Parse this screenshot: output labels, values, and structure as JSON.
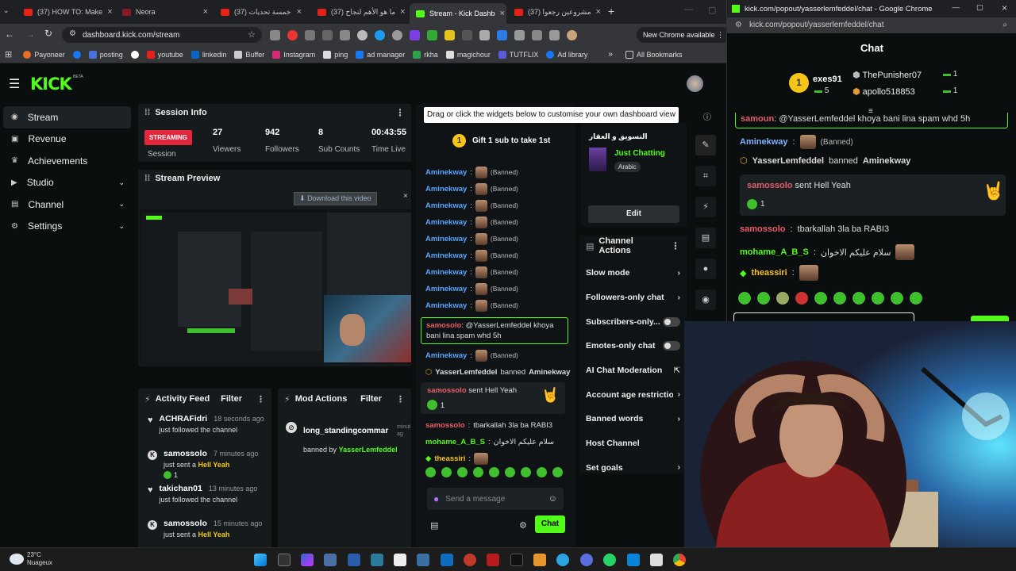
{
  "tabs": [
    {
      "label": "(37) HOW TO: Make",
      "color": "#e62117"
    },
    {
      "label": "Neora",
      "color": "#8a1a2a"
    },
    {
      "label": "(37) خمسة تحديات",
      "color": "#e62117"
    },
    {
      "label": "(37) ما هو الأهم لنجاح",
      "color": "#e62117"
    },
    {
      "label": "Stream - Kick Dashb",
      "color": "#53fc18"
    },
    {
      "label": "(37) مشروعين رجعوا",
      "color": "#e62117"
    }
  ],
  "address": {
    "url": "dashboard.kick.com/stream",
    "new_chrome": "New Chrome available"
  },
  "bookmarks": [
    "Payoneer",
    "posting",
    "youtube",
    "linkedin",
    "Buffer",
    "Instagram",
    "ping",
    "ad manager",
    "rkha",
    "magichour",
    "TUTFLIX",
    "Ad library"
  ],
  "bookmarks_all": "All Bookmarks",
  "kick_logo": "KICK",
  "kick_beta": "BETA",
  "nav": [
    {
      "label": "Stream",
      "icon": "broadcast-icon",
      "active": true
    },
    {
      "label": "Revenue",
      "icon": "wallet-icon"
    },
    {
      "label": "Achievements",
      "icon": "trophy-icon"
    },
    {
      "label": "Studio",
      "icon": "studio-icon",
      "chevron": true
    },
    {
      "label": "Channel",
      "icon": "channel-icon",
      "chevron": true
    },
    {
      "label": "Settings",
      "icon": "gear-icon",
      "chevron": true
    }
  ],
  "session": {
    "title": "Session Info",
    "status": "STREAMING",
    "status_sub": "Session",
    "stats": [
      {
        "value": "27",
        "label": "Viewers"
      },
      {
        "value": "942",
        "label": "Followers"
      },
      {
        "value": "8",
        "label": "Sub Counts"
      },
      {
        "value": "00:43:55",
        "label": "Time Live"
      }
    ]
  },
  "preview": {
    "title": "Stream Preview",
    "download": "Download this video"
  },
  "hint": "Drag or click the widgets below to customise your own dashboard view",
  "gift": "Gift 1 sub to take 1st",
  "stream_info": {
    "title": "التسويق و العقار",
    "category": "Just Chatting",
    "tag": "Arabic",
    "edit": "Edit"
  },
  "chat": {
    "banned_user": "Aminekway",
    "banned_label": "(Banned)",
    "banned_count": 9,
    "highlight_user": "samosolo",
    "highlight_msg": "@YasserLemfeddel khoya bani lina spam whd 5h",
    "mod_action_user": "YasserLemfeddel",
    "mod_action_text": "banned",
    "gift_user": "samossolo",
    "gift_text": "sent Hell Yeah",
    "gift_count": "1",
    "msg1_user": "samossolo",
    "msg1": "tbarkallah 3la ba RABI3",
    "msg2_user": "mohame_A_B_S",
    "msg2": "سلام عليكم الاخوان",
    "msg3_user": "theassiri",
    "placeholder": "Send a message",
    "send": "Chat"
  },
  "channel_actions": {
    "title": "Channel Actions",
    "items": [
      {
        "label": "Slow mode",
        "ctrl": "chevron"
      },
      {
        "label": "Followers-only chat",
        "ctrl": "chevron"
      },
      {
        "label": "Subscribers-only...",
        "ctrl": "toggle"
      },
      {
        "label": "Emotes-only chat",
        "ctrl": "toggle"
      },
      {
        "label": "AI Chat Moderation",
        "ctrl": "external"
      },
      {
        "label": "Account age restriction",
        "ctrl": "chevron"
      },
      {
        "label": "Banned words",
        "ctrl": "chevron"
      },
      {
        "label": "Host Channel",
        "ctrl": "none"
      },
      {
        "label": "Set goals",
        "ctrl": "chevron"
      }
    ]
  },
  "activity": {
    "title": "Activity Feed",
    "filter": "Filter",
    "items": [
      {
        "user": "ACHRAFidri",
        "time": "18 seconds ago",
        "desc": "just followed the channel",
        "icon": "heart-icon"
      },
      {
        "user": "samossolo",
        "time": "7 minutes ago",
        "desc": "just sent a",
        "gift": "Hell Yeah",
        "count": "1",
        "icon": "kick-icon"
      },
      {
        "user": "takichan01",
        "time": "13 minutes ago",
        "desc": "just followed the channel",
        "icon": "heart-icon"
      },
      {
        "user": "samossolo",
        "time": "15 minutes ago",
        "desc": "just sent a",
        "gift": "Hell Yeah",
        "icon": "kick-icon"
      }
    ]
  },
  "mod_actions": {
    "title": "Mod Actions",
    "filter": "Filter",
    "user": "long_standingcommar",
    "time": "minut ag",
    "banned_by": "banned by",
    "mod": "YasserLemfeddel"
  },
  "popout": {
    "window_title": "kick.com/popout/yasserlemfeddel/chat - Google Chrome",
    "url": "kick.com/popout/yasserlemfeddel/chat",
    "header": "Chat",
    "leader1": {
      "rank": "1",
      "name": "exes91",
      "count": "5"
    },
    "leader2": {
      "name": "ThePunisher07",
      "count": "1"
    },
    "leader3": {
      "name": "apollo518853",
      "count": "1"
    },
    "highlight": "@YasserLemfeddel khoya bani lina spam whd 5h",
    "highlight_user": "samoun",
    "banned_user": "Aminekway",
    "banned_label": "(Banned)",
    "mod": "YasserLemfeddel",
    "mod_text": "banned",
    "gift_user": "samossolo",
    "gift_text": "sent Hell Yeah",
    "gift_count": "1",
    "m1_user": "samossolo",
    "m1": "tbarkallah 3la ba RABI3",
    "m2_user": "mohame_A_B_S",
    "m2": "سلام عليكم الاخوان",
    "m3_user": "theassiri"
  },
  "weather": {
    "temp": "23°C",
    "desc": "Nuageux"
  }
}
